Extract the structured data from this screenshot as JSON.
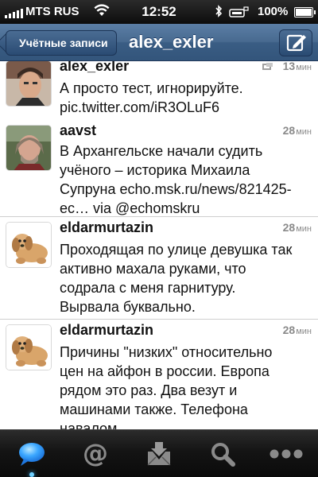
{
  "status_bar": {
    "carrier": "MTS RUS",
    "time": "12:52",
    "battery": "100%",
    "battery_level": 1.0,
    "signal_bars": 5
  },
  "nav": {
    "back_label": "Учётные записи",
    "title": "alex_exler",
    "compose_icon": "compose-icon"
  },
  "tweets": [
    {
      "user": "alex_exler",
      "time": "13",
      "time_unit": "мин",
      "lines": [
        "А просто тест, игнорируйте.",
        "pic.twitter.com/iR3OLuF6"
      ],
      "avatar_icon": "avatar-photo",
      "retweet_icon": "retweet-icon"
    },
    {
      "user": "aavst",
      "time": "28",
      "time_unit": "мин",
      "lines": [
        "В Архангельске начали судить",
        "учёного – историка Михаила",
        "Супруна echo.msk.ru/news/821425-",
        "ec… via @echomskru"
      ],
      "avatar_icon": "avatar-photo"
    },
    {
      "user": "eldarmurtazin",
      "time": "28",
      "time_unit": "мин",
      "lines": [
        "Проходящая по улице девушка так",
        "активно махала руками, что",
        "содрала с меня гарнитуру.",
        "Вырвала буквально."
      ],
      "avatar_icon": "avatar-dog"
    },
    {
      "user": "eldarmurtazin",
      "time": "28",
      "time_unit": "мин",
      "lines": [
        "Причины \"низких\" относительно",
        "цен на айфон в россии. Европа",
        "рядом это раз. Два везут и",
        "машинами также. Телефона",
        "навалом"
      ],
      "avatar_icon": "avatar-dog"
    }
  ],
  "tabs": [
    {
      "icon": "timeline-bubble-icon",
      "active": true
    },
    {
      "icon": "mentions-at-icon",
      "active": false
    },
    {
      "icon": "messages-inbox-icon",
      "active": false
    },
    {
      "icon": "search-icon",
      "active": false
    },
    {
      "icon": "more-dots-icon",
      "active": false
    }
  ],
  "colors": {
    "nav_blue": "#3a5d84",
    "status_bar": "#111111",
    "tab_bar": "#141414",
    "active_tab": "#4ab3ff",
    "meta_gray": "#8a8a8a"
  }
}
